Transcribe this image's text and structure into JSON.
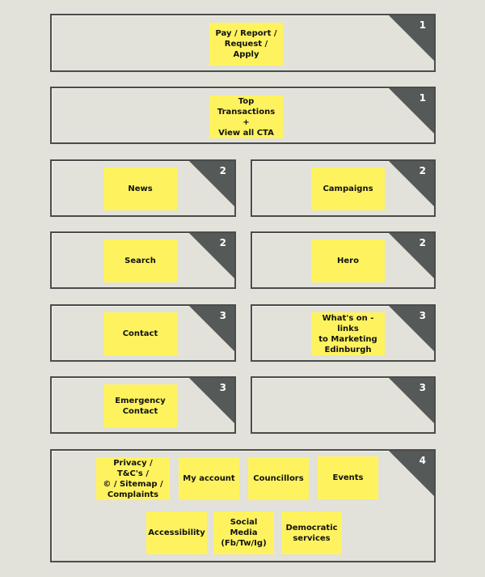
{
  "colors": {
    "background": "#e2e1da",
    "panel_border": "#4a4d4b",
    "corner_fill": "#555957",
    "sticky_note": "#fef35f",
    "note_text": "#111111",
    "priority_text": "#ffffff"
  },
  "panels": [
    {
      "id": "full-1",
      "priority": "1",
      "notes": [
        "Pay / Report /\nRequest / Apply"
      ]
    },
    {
      "id": "full-2",
      "priority": "1",
      "notes": [
        "Top\nTransactions +\nView all CTA"
      ]
    },
    {
      "id": "news",
      "priority": "2",
      "notes": [
        "News"
      ]
    },
    {
      "id": "campaigns",
      "priority": "2",
      "notes": [
        "Campaigns"
      ]
    },
    {
      "id": "search",
      "priority": "2",
      "notes": [
        "Search"
      ]
    },
    {
      "id": "hero",
      "priority": "2",
      "notes": [
        "Hero"
      ]
    },
    {
      "id": "contact",
      "priority": "3",
      "notes": [
        "Contact"
      ]
    },
    {
      "id": "whats-on",
      "priority": "3",
      "notes": [
        "What's on - links\nto Marketing\nEdinburgh"
      ]
    },
    {
      "id": "emergency",
      "priority": "3",
      "notes": [
        "Emergency\nContact"
      ]
    },
    {
      "id": "empty",
      "priority": "3",
      "notes": []
    },
    {
      "id": "footer",
      "priority": "4",
      "notes": [
        "Privacy / T&C's /\n© / Sitemap /\nComplaints",
        "My account",
        "Councillors",
        "Events",
        "Accessibility",
        "Social Media\n(Fb/Tw/Ig)",
        "Democratic\nservices"
      ]
    }
  ]
}
